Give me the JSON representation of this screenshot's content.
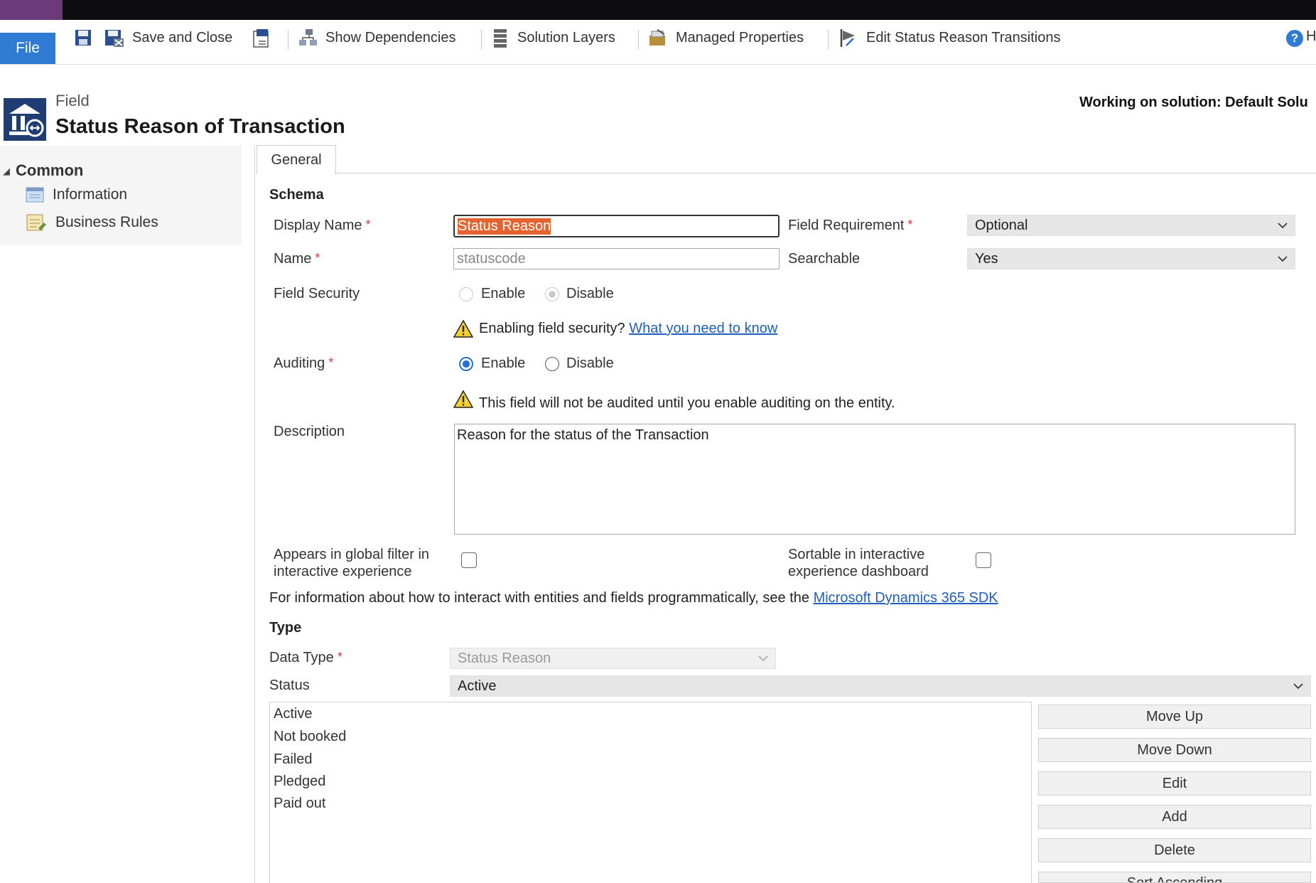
{
  "ribbon": {
    "file_label": "File",
    "save_and_close": "Save and Close",
    "show_dependencies": "Show Dependencies",
    "solution_layers": "Solution Layers",
    "managed_properties": "Managed Properties",
    "edit_status_reason_transitions": "Edit Status Reason Transitions"
  },
  "header": {
    "kind": "Field",
    "title": "Status Reason of Transaction",
    "working_on": "Working on solution: Default Solu"
  },
  "nav": {
    "group": "Common",
    "items": [
      {
        "label": "Information",
        "icon": "information-icon"
      },
      {
        "label": "Business Rules",
        "icon": "business-rules-icon"
      }
    ]
  },
  "tabs": [
    "General"
  ],
  "schema": {
    "heading": "Schema",
    "display_name_label": "Display Name",
    "display_name_value": "Status Reason",
    "name_label": "Name",
    "name_value": "statuscode",
    "field_requirement_label": "Field Requirement",
    "field_requirement_value": "Optional",
    "searchable_label": "Searchable",
    "searchable_value": "Yes",
    "field_security_label": "Field Security",
    "field_security_enable": "Enable",
    "field_security_disable": "Disable",
    "field_security_warning": "Enabling field security?",
    "field_security_link": "What you need to know",
    "auditing_label": "Auditing",
    "auditing_enable": "Enable",
    "auditing_disable": "Disable",
    "auditing_selected": "Enable",
    "auditing_warning": "This field will not be audited until you enable auditing on the entity.",
    "description_label": "Description",
    "description_value": "Reason for the status of the Transaction",
    "global_filter_label_1": "Appears in global filter in",
    "global_filter_label_2": "interactive experience",
    "sortable_label_1": "Sortable in interactive",
    "sortable_label_2": "experience dashboard",
    "sdk_text": "For information about how to interact with entities and fields programmatically, see the",
    "sdk_link": "Microsoft Dynamics 365 SDK"
  },
  "type": {
    "heading": "Type",
    "data_type_label": "Data Type",
    "data_type_value": "Status Reason",
    "status_label": "Status",
    "status_value": "Active",
    "options": [
      "Active",
      "Not booked",
      "Failed",
      "Pledged",
      "Paid out"
    ],
    "buttons": [
      "Move Up",
      "Move Down",
      "Edit",
      "Add",
      "Delete",
      "Sort Ascending"
    ]
  }
}
